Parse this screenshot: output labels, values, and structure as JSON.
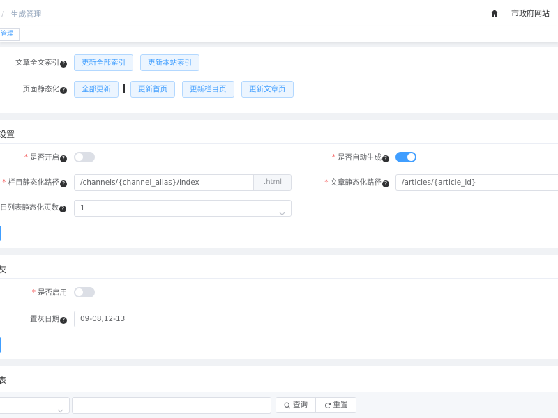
{
  "navbar": {
    "breadcrumb_sep": "/",
    "breadcrumb_current": "生成管理",
    "site_name": "市政府网站"
  },
  "tagbar": {
    "tag_label": "管理"
  },
  "operations": {
    "fulltext_label": "文章全文索引",
    "update_all_index": "更新全部索引",
    "update_site_index": "更新本站索引",
    "static_label": "页面静态化",
    "update_all": "全部更新",
    "update_home": "更新首页",
    "update_channel": "更新栏目页",
    "update_article": "更新文章页"
  },
  "static_settings": {
    "title": "设置",
    "enable_label": "是否开启",
    "enable_on": false,
    "auto_label": "是否自动生成",
    "auto_on": true,
    "channel_path_label": "栏目静态化路径",
    "channel_path_value": "/channels/{channel_alias}/index",
    "channel_path_suffix": ".html",
    "article_path_label": "文章静态化路径",
    "article_path_value": "/articles/{article_id}",
    "list_pages_label": "目列表静态化页数",
    "list_pages_value": "1"
  },
  "gray_settings": {
    "title": "灰",
    "enable_label": "是否启用",
    "enable_on": false,
    "date_label": "置灰日期",
    "date_value": "09-08,12-13"
  },
  "list_section": {
    "title": "表",
    "select_value": "",
    "search_value": "",
    "query_label": "查询",
    "reset_label": "重置"
  },
  "colors": {
    "primary": "#409eff",
    "danger": "#f56c6c",
    "background": "#f0f2f5"
  }
}
